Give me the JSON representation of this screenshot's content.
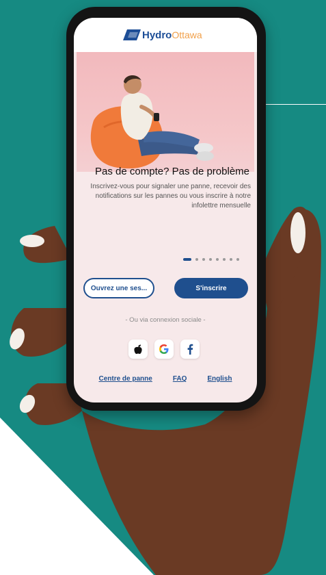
{
  "brand": {
    "name_primary": "Hydro",
    "name_secondary": "Ottawa"
  },
  "hero": {
    "headline": "Pas de compte? Pas de problème",
    "subtext": "Inscrivez-vous pour signaler une panne, recevoir des notifications sur les pannes ou vous inscrire à notre infolettre mensuelle"
  },
  "carousel": {
    "total": 8,
    "active_index": 0
  },
  "buttons": {
    "open_session": "Ouvrez une ses...",
    "signup": "S'inscrire"
  },
  "social": {
    "label": "- Ou via connexion sociale -",
    "icons": [
      "apple-icon",
      "google-icon",
      "facebook-icon"
    ]
  },
  "footer_links": {
    "outage_center": "Centre de panne",
    "faq": "FAQ",
    "language": "English"
  },
  "colors": {
    "primary": "#1f4f8e",
    "accent": "#f1a04a",
    "background_teal": "#168a82"
  }
}
